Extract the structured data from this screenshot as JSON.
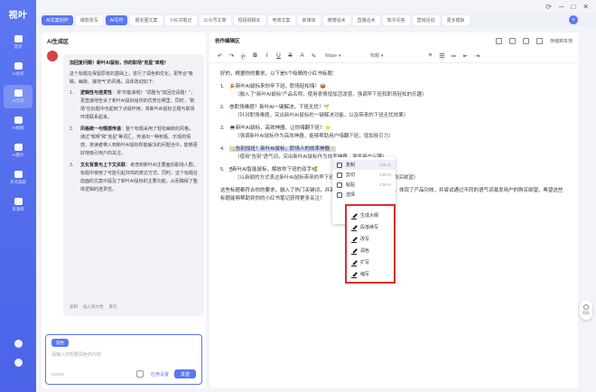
{
  "app": {
    "logo": "视叶",
    "window_controls": [
      "⟳",
      "─",
      "□",
      "✕"
    ]
  },
  "rail": {
    "items": [
      {
        "label": "首页",
        "icon": "home-icon"
      },
      {
        "label": "AI创作",
        "icon": "mail-icon"
      },
      {
        "label": "AI写作",
        "icon": "document-icon",
        "active": true
      },
      {
        "label": "AI视频",
        "icon": "video-icon"
      },
      {
        "label": "AI图片",
        "icon": "image-icon"
      },
      {
        "label": "热点追踪",
        "icon": "trend-icon"
      },
      {
        "label": "资源库",
        "icon": "folder-icon"
      }
    ],
    "bottom": [
      "user-icon",
      "help-icon"
    ]
  },
  "tabs": [
    {
      "label": "AI文案创作"
    },
    {
      "label": "爆款改写"
    },
    {
      "label": "AI写作",
      "active": true
    },
    {
      "label": "朋友圈文案"
    },
    {
      "label": "小红书笔记"
    },
    {
      "label": "公众号文章"
    },
    {
      "label": "短视频脚本"
    },
    {
      "label": "电商文案"
    },
    {
      "label": "新媒体"
    },
    {
      "label": "微博话术"
    },
    {
      "label": "直播话术"
    },
    {
      "label": "知乎问答"
    },
    {
      "label": "营销活动"
    },
    {
      "label": "更多模板"
    }
  ],
  "chat": {
    "title": "AI生成区",
    "bubble": {
      "heading": "加回复问题！新叶AI鼠标，你的职场\"克星\"来啦！",
      "intro": "这个标题在保留原有的基础上，进行了润色和优化，更符合\"吸睛、幽默、接地气\"的风格。具体改动如下：",
      "sections": [
        {
          "n": "1.",
          "title": "逻辑性与连贯性",
          "text": "：将\"你能来啦！\"调整为\"加回应请题！\"，更直接地告诉了新叶AI鼠标给你的优势在哪里，同时，\"职场\"在标题中也起到了点缀作用，将新叶AI鼠标主题与职场环境联系起来。"
        },
        {
          "n": "2.",
          "title": "风格统一与情感传递",
          "text": "：整个标题采用了轻松幽默的风格，通过\"嘿呀\"和\"克星\"等词汇，传递出一种积极、乐观的情感，将读者带入到新叶AI鼠标所能解决的问题当中，能够更好地吸引用户的关注。"
        },
        {
          "n": "3.",
          "title": "文化背景与上下文关联",
          "text": "：考虑到新叶AI主要面向职场人群，标题中使用了可能引起共鸣的表达方式。同时，这个标题在前面的文案中提及了新叶AI鼠标的主要功能，从而确保了整体逻辑的连贯性。"
        }
      ],
      "actions": [
        "复制",
        "插入到文档",
        "重写"
      ]
    },
    "input": {
      "tag": "润色",
      "placeholder": "请输入你想要润色的内容",
      "counter": "0/2000",
      "link": "应用设置",
      "send": "发送"
    }
  },
  "editor": {
    "title": "创作编辑区",
    "save_label": "存储到本地",
    "toolbar": {
      "font": "Nique",
      "size": "标题",
      "items": [
        "↶",
        "↷",
        "Ⓟ",
        "B",
        "I",
        "U",
        "S",
        "A",
        "✎",
        "≡",
        "☰",
        "≔",
        "⇤",
        "⇥"
      ]
    },
    "intro": "好的，根据你的要求，以下是5个吸睛的小红书标题：",
    "items": [
      {
        "n": "1.",
        "title": "🎉新叶AI鼠标来你辛下班，职场轻松嗨！📦",
        "sub": "（融入了\"新叶AI鼠标\"产品名称，使用表情增加活泼感，强调早下班和职场轻松的乐趣）"
      },
      {
        "n": "2.",
        "title": "😎职场难题？新叶AI一键解决，下班无忧！🌱",
        "sub": "（针对职场难题，突出新叶AI鼠标的一键解决功能，以及带来的下班无忧效果）"
      },
      {
        "n": "3.",
        "title": "💻新叶AI鼠标，高效神器，让你嗨翻下班！🌟",
        "sub": "（强调新叶AI鼠标作为高效神器，能够帮助用户嗨翻下班，增加吸引力）"
      },
      {
        "n": "4.",
        "title": "💫告别加班！新叶AI鼠标，职场人的效率神器✨",
        "sub": "（使用\"告别\"语气词，突出新叶AI鼠标作为效率神器，激发用户兴趣）"
      },
      {
        "n": "5.",
        "title": "🖱新叶AI智能鼠标，解放你下班的双手🌿",
        "sub": "（以新颖的方式表达新叶AI鼠标带来的早下班福利，激发读者的好奇心和购买欲望）"
      }
    ],
    "outro": "这些标题都符合你的要求，融入了热门关键词，并采用了活泼的语气和表情符号，体现了产品功效，并尝试通过不同的语气词激发用户的购买欲望。希望这些标题能够帮助到你的小红书笔记获得更多关注！"
  },
  "context_menu": {
    "items": [
      {
        "label": "复制",
        "kbd": "Ctrl+C",
        "icon": "copy-icon"
      },
      {
        "label": "剪切",
        "kbd": "Ctrl+X",
        "icon": "cut-icon"
      },
      {
        "label": "粘贴",
        "kbd": "Ctrl+V",
        "icon": "paste-icon"
      },
      {
        "label": "选择",
        "kbd": "",
        "icon": "select-icon"
      }
    ]
  },
  "ai_menu": {
    "items": [
      "生成大纲",
      "段落续写",
      "改写",
      "润色",
      "扩写",
      "缩写"
    ]
  },
  "side_float": {
    "label": "帮助"
  }
}
